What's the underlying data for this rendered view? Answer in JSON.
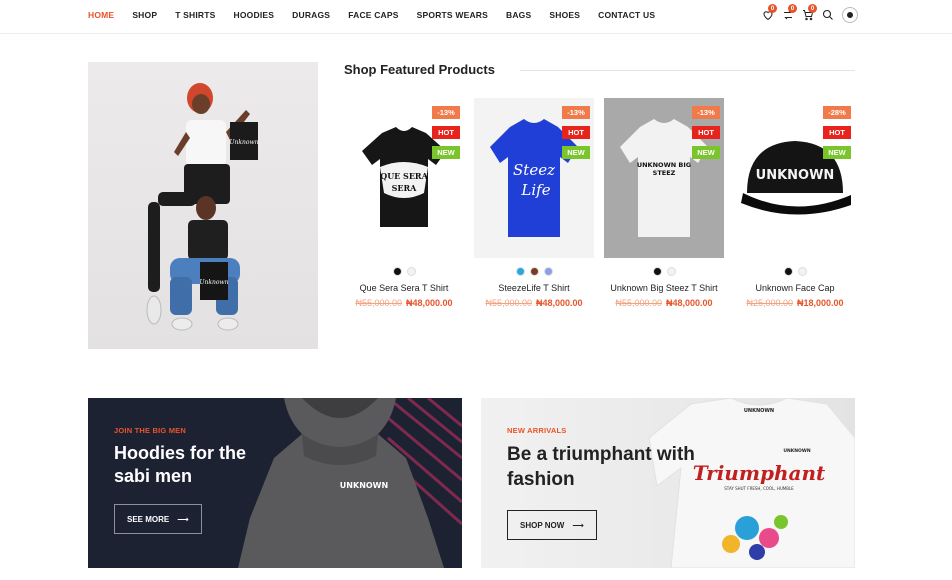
{
  "nav": {
    "links": [
      "HOME",
      "SHOP",
      "T SHIRTS",
      "HOODIES",
      "DURAGS",
      "FACE CAPS",
      "SPORTS WEARS",
      "BAGS",
      "SHOES",
      "CONTACT US"
    ],
    "wishlist_count": "0",
    "compare_count": "0",
    "cart_count": "0"
  },
  "featured": {
    "title": "Shop Featured Products",
    "products": [
      {
        "name": "Que Sera Sera T Shirt",
        "old_price": "₦55,000.00",
        "price": "₦48,000.00",
        "discount": "-13%",
        "hot": "HOT",
        "new": "NEW",
        "print": "QUE SERA SERA",
        "colors": [
          "#111111",
          "#f2f2f2"
        ]
      },
      {
        "name": "SteezeLife T Shirt",
        "old_price": "₦55,000.00",
        "price": "₦48,000.00",
        "discount": "-13%",
        "hot": "HOT",
        "new": "NEW",
        "print": "Steez Life",
        "colors": [
          "#2aa7e0",
          "#7a3b22",
          "#8aa0e8"
        ]
      },
      {
        "name": "Unknown Big Steez T Shirt",
        "old_price": "₦55,000.00",
        "price": "₦48,000.00",
        "discount": "-13%",
        "hot": "HOT",
        "new": "NEW",
        "print": "UNKNOWN BIG STEEZ",
        "colors": [
          "#111111",
          "#f2f2f2"
        ]
      },
      {
        "name": "Unknown Face Cap",
        "old_price": "₦25,000.00",
        "price": "₦18,000.00",
        "discount": "-28%",
        "hot": "HOT",
        "new": "NEW",
        "print": "UNKNOWN",
        "colors": [
          "#111111",
          "#f2f2f2"
        ]
      }
    ]
  },
  "promo_photo": {
    "bag_text": "Unknown"
  },
  "banners": {
    "left": {
      "eyebrow": "JOIN THE BIG MEN",
      "title": "Hoodies for the sabi men",
      "button": "SEE MORE",
      "print": "UNKNOWN"
    },
    "right": {
      "eyebrow": "NEW ARRIVALS",
      "title": "Be a triumphant with fashion",
      "button": "SHOP NOW",
      "print": "Triumphant",
      "subprint": "STAY SHUT FRESH, COOL, HUMBLE",
      "logo": "UNKNOWN"
    }
  },
  "colors": {
    "accent": "#e8542a",
    "hot": "#e8231c",
    "new": "#7bc52c",
    "dark_banner": "#1d2233"
  }
}
